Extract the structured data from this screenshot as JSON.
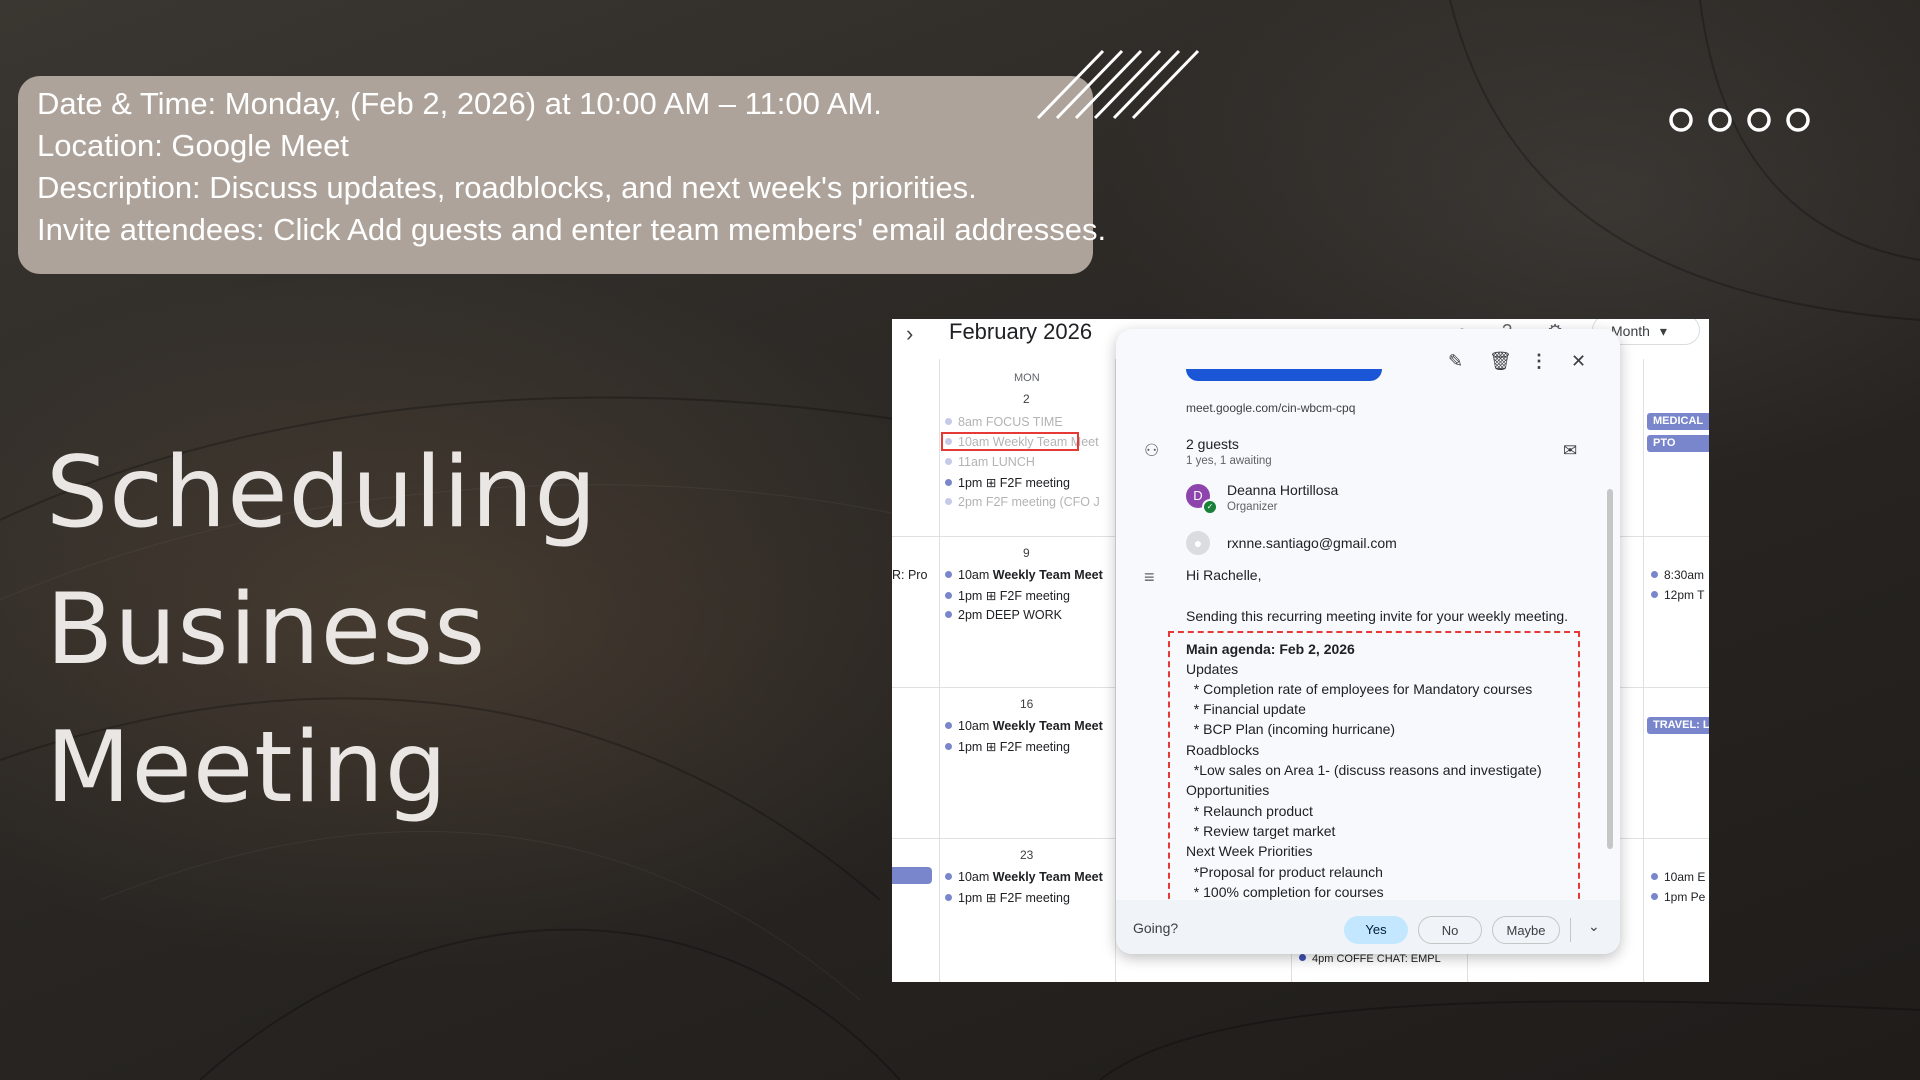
{
  "info": {
    "lines": [
      "Date & Time: Monday, (Feb 2, 2026) at 10:00 AM – 11:00 AM.",
      "Location: Google Meet",
      "Description: Discuss updates, roadblocks, and next week's priorities.",
      "Invite attendees: Click Add guests and enter team members' email addresses."
    ]
  },
  "title": {
    "line1": "Scheduling",
    "line2": "Business",
    "line3": "Meeting"
  },
  "calendar": {
    "header": {
      "chevron": "›",
      "month_title": "February 2026",
      "view": "Month",
      "view_caret": "▾"
    },
    "day_of_week": "MON",
    "weeks": [
      {
        "day": "2",
        "events": [
          {
            "time": "8am",
            "name": "FOCUS TIME"
          },
          {
            "time": "10am",
            "name": "Weekly Team Meet"
          },
          {
            "time": "11am",
            "name": "LUNCH"
          },
          {
            "time": "1pm",
            "name": "⊞ F2F meeting"
          },
          {
            "time": "2pm",
            "name": "F2F meeting (CFO J"
          }
        ]
      },
      {
        "day": "9",
        "events": [
          {
            "time": "10am",
            "name": "Weekly Team Meet"
          },
          {
            "time": "1pm",
            "name": "⊞ F2F meeting"
          },
          {
            "time": "2pm",
            "name": "DEEP WORK"
          }
        ]
      },
      {
        "day": "16",
        "events": [
          {
            "time": "10am",
            "name": "Weekly Team Meet"
          },
          {
            "time": "1pm",
            "name": "⊞ F2F meeting"
          }
        ]
      },
      {
        "day": "23",
        "events": [
          {
            "time": "10am",
            "name": "Weekly Team Meet"
          },
          {
            "time": "1pm",
            "name": "⊞ F2F meeting"
          }
        ]
      }
    ],
    "left_partial": "R: Pro",
    "right_chips": [
      "MEDICAL",
      "PTO",
      "TRAVEL: L"
    ],
    "right_events": [
      "8:30am",
      "12pm T",
      "10am E",
      "1pm Pe"
    ],
    "bottom_event": "4pm COFFE CHAT: EMPL"
  },
  "popup": {
    "meet_link": "meet.google.com/cin-wbcm-cpq",
    "guests_count": "2 guests",
    "guests_status": "1 yes, 1 awaiting",
    "organizer": {
      "initial": "D",
      "name": "Deanna Hortillosa",
      "role": "Organizer"
    },
    "guest_email": "rxnne.santiago@gmail.com",
    "greeting": "Hi Rachelle,",
    "message": "Sending this recurring meeting invite for your weekly meeting.",
    "agenda": {
      "heading": "Main agenda:  Feb 2, 2026",
      "lines": [
        "Updates",
        "  * Completion rate of employees for Mandatory courses",
        "  * Financial update",
        "  * BCP Plan (incoming hurricane)",
        "Roadblocks",
        "  *Low sales on Area 1- (discuss reasons and investigate)",
        "Opportunities",
        "  * Relaunch product",
        "  * Review target market",
        "Next Week Priorities",
        "  *Proposal for product relaunch",
        "  * 100% completion for courses"
      ]
    },
    "going_label": "Going?",
    "rsvp": {
      "yes": "Yes",
      "no": "No",
      "maybe": "Maybe"
    }
  },
  "colors": {
    "info_box": "#ada39a",
    "event_dot": "#7986cb",
    "highlight": "#e53935",
    "yes_pill": "#c2e7ff"
  }
}
